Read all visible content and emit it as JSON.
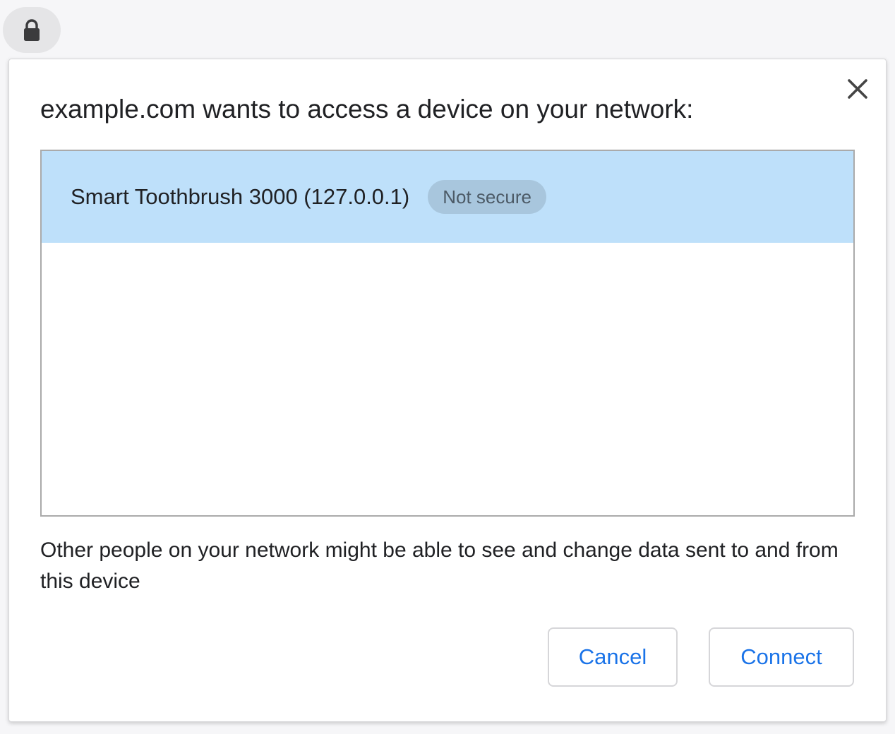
{
  "toolbar": {
    "lock_icon": "lock-icon"
  },
  "dialog": {
    "title": "example.com wants to access a device on your network:",
    "close_icon": "close-icon",
    "devices": [
      {
        "name": "Smart Toothbrush 3000 (127.0.0.1)",
        "badge": "Not secure",
        "selected": true
      }
    ],
    "warning": "Other people on your network might be able to see and change data sent to and from this device",
    "cancel_label": "Cancel",
    "connect_label": "Connect"
  },
  "colors": {
    "page_background": "#f6f6f8",
    "selected_row": "#bee0fa",
    "badge_background": "#a8c6dd",
    "button_text": "#1a73e8"
  }
}
